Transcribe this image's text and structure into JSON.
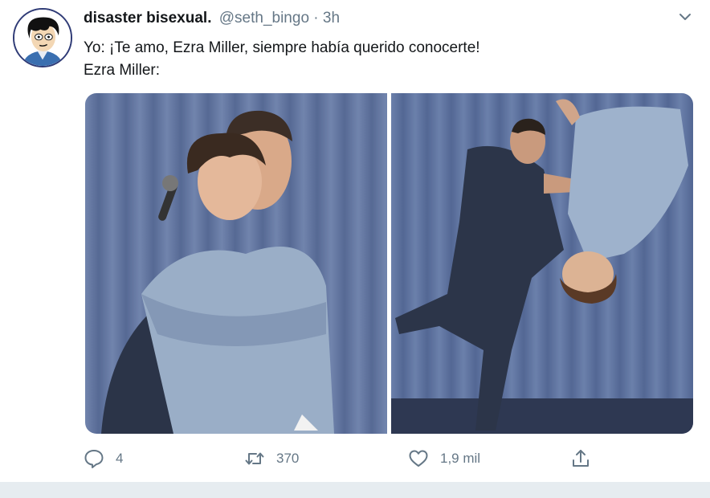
{
  "tweet": {
    "display_name": "disaster bisexual.",
    "handle": "@seth_bingo",
    "separator": "·",
    "time": "3h",
    "lines": [
      "Yo: ¡Te amo, Ezra Miller, siempre había querido conocerte!",
      "Ezra Miller:"
    ]
  },
  "actions": {
    "reply_count": "4",
    "retweet_count": "370",
    "like_count": "1,9 mil"
  },
  "icons": {
    "reply": "speech-bubble-icon",
    "retweet": "retweet-arrows-icon",
    "like": "heart-icon",
    "share": "share-upload-icon",
    "menu": "chevron-down-icon"
  },
  "colors": {
    "text": "#14171a",
    "secondary": "#657786",
    "curtain": "#5d7099",
    "background": "#ffffff"
  }
}
